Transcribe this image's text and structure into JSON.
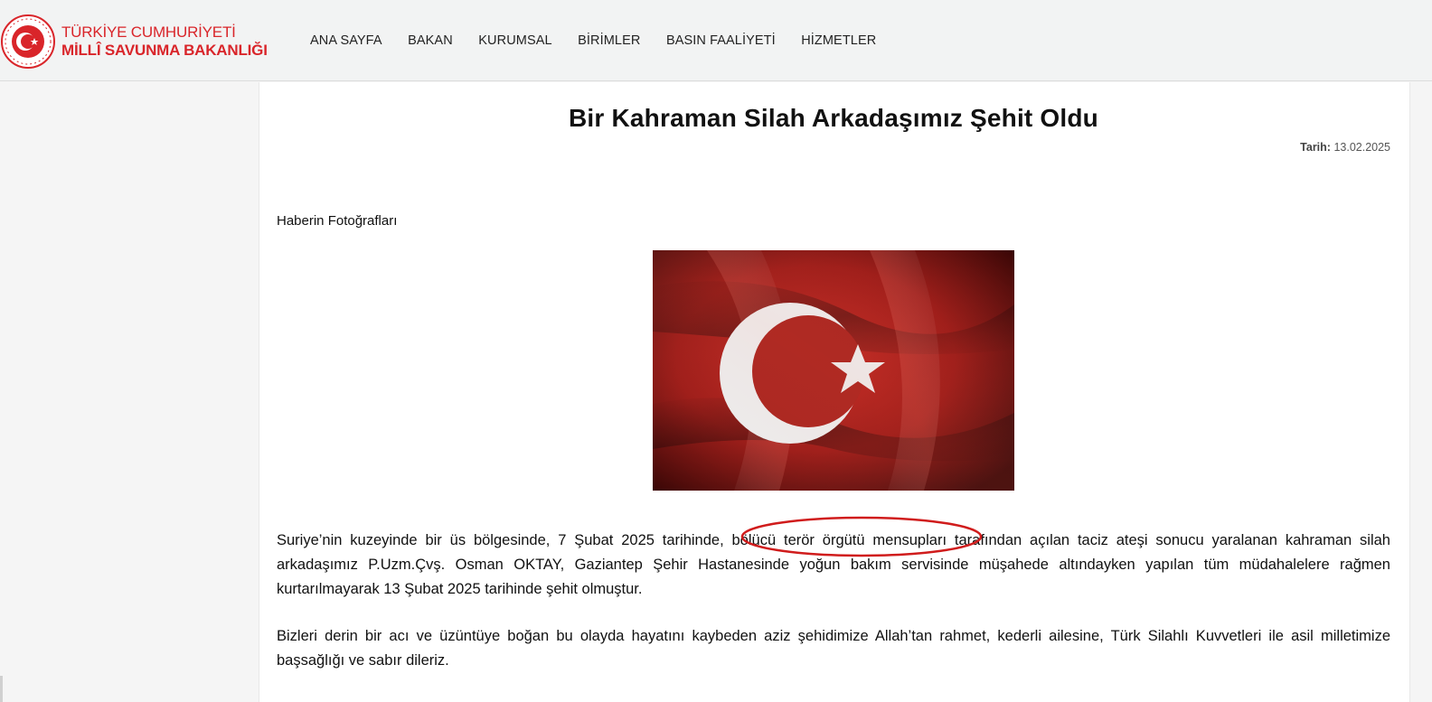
{
  "header": {
    "logo_line1": "TÜRKİYE CUMHURİYETİ",
    "logo_line2": "MİLLÎ SAVUNMA BAKANLIĞI",
    "brand_color": "#d9252a",
    "nav": [
      "ANA SAYFA",
      "BAKAN",
      "KURUMSAL",
      "BİRİMLER",
      "BASIN FAALİYETİ",
      "HİZMETLER"
    ]
  },
  "article": {
    "title": "Bir Kahraman Silah Arkadaşımız Şehit Oldu",
    "date_label": "Tarih:",
    "date_value": "13.02.2025",
    "photos_label": "Haberin Fotoğrafları",
    "photo_icon": "turkish-flag-image",
    "paragraph1": "Suriye’nin kuzeyinde bir üs bölgesinde, 7 Şubat 2025 tarihinde, bölücü terör örgütü mensupları tarafından açılan taciz ateşi sonucu yaralanan kahraman silah arkadaşımız P.Uzm.Çvş. Osman OKTAY, Gaziantep Şehir Hastanesinde yoğun bakım servisinde müşahede altındayken yapılan tüm müdahalelere rağmen kurtarılmayarak 13 Şubat 2025 tarihinde şehit olmuştur.",
    "paragraph2": "Bizleri derin bir acı ve üzüntüye boğan bu olayda hayatını kaybeden aziz şehidimize Allah’tan rahmet, kederli ailesine, Türk Silahlı Kuvvetleri ile asil milletimize başsağlığı ve sabır dileriz."
  },
  "annotation_color": "#d01c1c"
}
